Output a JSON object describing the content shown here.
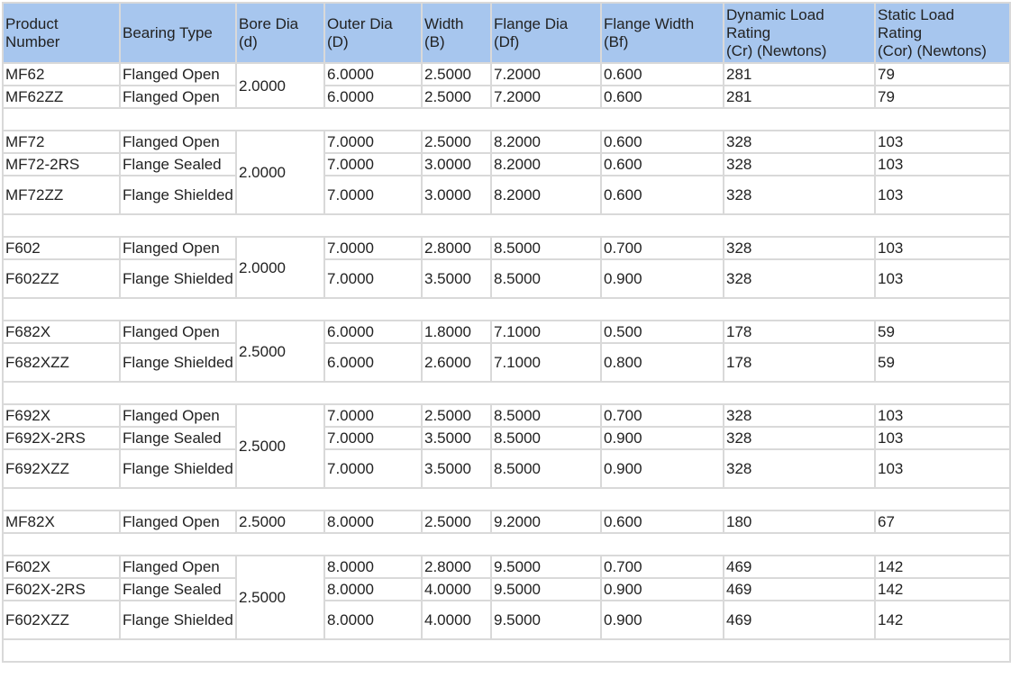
{
  "columns": [
    {
      "key": "product",
      "lines": [
        "Product",
        "Number"
      ]
    },
    {
      "key": "type",
      "lines": [
        "Bearing Type"
      ]
    },
    {
      "key": "bore",
      "lines": [
        "Bore Dia",
        "(d)"
      ]
    },
    {
      "key": "outer",
      "lines": [
        "Outer Dia",
        "(D)"
      ]
    },
    {
      "key": "width",
      "lines": [
        "Width",
        "(B)"
      ]
    },
    {
      "key": "flange_dia",
      "lines": [
        "Flange Dia",
        "(Df)"
      ]
    },
    {
      "key": "flange_width",
      "lines": [
        "Flange Width",
        "(Bf)"
      ]
    },
    {
      "key": "dynamic",
      "lines": [
        "Dynamic Load",
        "Rating",
        "(Cr) (Newtons)"
      ]
    },
    {
      "key": "static",
      "lines": [
        "Static Load",
        "Rating",
        "(Cor) (Newtons)"
      ]
    }
  ],
  "groups": [
    {
      "bore": "2.0000",
      "rows": [
        {
          "product": "MF62",
          "type": "Flanged Open",
          "outer": "6.0000",
          "width": "2.5000",
          "flange_dia": "7.2000",
          "flange_width": "0.600",
          "dynamic": "281",
          "static": "79"
        },
        {
          "product": "MF62ZZ",
          "type": "Flanged Open",
          "outer": "6.0000",
          "width": "2.5000",
          "flange_dia": "7.2000",
          "flange_width": "0.600",
          "dynamic": "281",
          "static": "79"
        }
      ]
    },
    {
      "bore": "2.0000",
      "rows": [
        {
          "product": "MF72",
          "type": "Flanged Open",
          "outer": "7.0000",
          "width": "2.5000",
          "flange_dia": "8.2000",
          "flange_width": "0.600",
          "dynamic": "328",
          "static": "103"
        },
        {
          "product": "MF72-2RS",
          "type": "Flange Sealed",
          "outer": "7.0000",
          "width": "3.0000",
          "flange_dia": "8.2000",
          "flange_width": "0.600",
          "dynamic": "328",
          "static": "103"
        },
        {
          "product": "MF72ZZ",
          "type": "Flange Shielded",
          "outer": "7.0000",
          "width": "3.0000",
          "flange_dia": "8.2000",
          "flange_width": "0.600",
          "dynamic": "328",
          "static": "103"
        }
      ]
    },
    {
      "bore": "2.0000",
      "rows": [
        {
          "product": "F602",
          "type": "Flanged Open",
          "outer": "7.0000",
          "width": "2.8000",
          "flange_dia": "8.5000",
          "flange_width": "0.700",
          "dynamic": "328",
          "static": "103"
        },
        {
          "product": "F602ZZ",
          "type": "Flange Shielded",
          "outer": "7.0000",
          "width": "3.5000",
          "flange_dia": "8.5000",
          "flange_width": "0.900",
          "dynamic": "328",
          "static": "103"
        }
      ]
    },
    {
      "bore": "2.5000",
      "rows": [
        {
          "product": "F682X",
          "type": "Flanged Open",
          "outer": "6.0000",
          "width": "1.8000",
          "flange_dia": "7.1000",
          "flange_width": "0.500",
          "dynamic": "178",
          "static": "59"
        },
        {
          "product": "F682XZZ",
          "type": "Flange Shielded",
          "outer": "6.0000",
          "width": "2.6000",
          "flange_dia": "7.1000",
          "flange_width": "0.800",
          "dynamic": "178",
          "static": "59"
        }
      ]
    },
    {
      "bore": "2.5000",
      "rows": [
        {
          "product": "F692X",
          "type": "Flanged Open",
          "outer": "7.0000",
          "width": "2.5000",
          "flange_dia": "8.5000",
          "flange_width": "0.700",
          "dynamic": "328",
          "static": "103"
        },
        {
          "product": "F692X-2RS",
          "type": "Flange Sealed",
          "outer": "7.0000",
          "width": "3.5000",
          "flange_dia": "8.5000",
          "flange_width": "0.900",
          "dynamic": "328",
          "static": "103"
        },
        {
          "product": "F692XZZ",
          "type": "Flange Shielded",
          "outer": "7.0000",
          "width": "3.5000",
          "flange_dia": "8.5000",
          "flange_width": "0.900",
          "dynamic": "328",
          "static": "103"
        }
      ]
    },
    {
      "bore": "2.5000",
      "rows": [
        {
          "product": "MF82X",
          "type": "Flanged Open",
          "outer": "8.0000",
          "width": "2.5000",
          "flange_dia": "9.2000",
          "flange_width": "0.600",
          "dynamic": "180",
          "static": "67"
        }
      ]
    },
    {
      "bore": "2.5000",
      "rows": [
        {
          "product": "F602X",
          "type": "Flanged Open",
          "outer": "8.0000",
          "width": "2.8000",
          "flange_dia": "9.5000",
          "flange_width": "0.700",
          "dynamic": "469",
          "static": "142"
        },
        {
          "product": "F602X-2RS",
          "type": "Flange Sealed",
          "outer": "8.0000",
          "width": "4.0000",
          "flange_dia": "9.5000",
          "flange_width": "0.900",
          "dynamic": "469",
          "static": "142"
        },
        {
          "product": "F602XZZ",
          "type": "Flange Shielded",
          "outer": "8.0000",
          "width": "4.0000",
          "flange_dia": "9.5000",
          "flange_width": "0.900",
          "dynamic": "469",
          "static": "142"
        }
      ]
    }
  ],
  "colors": {
    "header_bg": "#a7c6ee",
    "border": "#d9d9d9",
    "text": "#222222"
  }
}
